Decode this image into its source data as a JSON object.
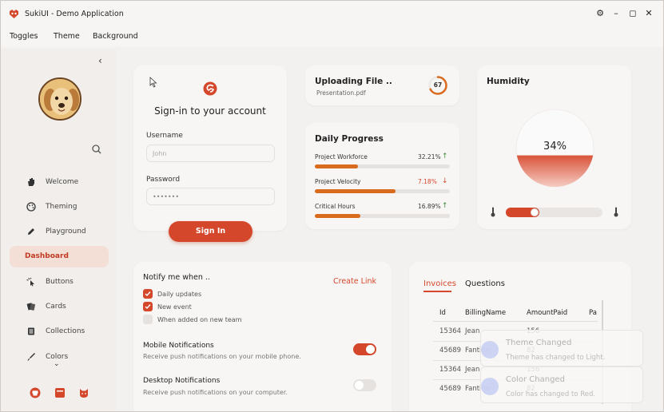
{
  "window": {
    "title": "SukiUI - Demo Application"
  },
  "menu": [
    "Toggles",
    "Theme",
    "Background"
  ],
  "sidebar": {
    "items": [
      {
        "label": "Welcome",
        "icon": "hand-wave-icon"
      },
      {
        "label": "Theming",
        "icon": "palette-icon"
      },
      {
        "label": "Playground",
        "icon": "pencil-icon"
      },
      {
        "label": "Dashboard",
        "icon": "dashboard-icon",
        "active": true
      },
      {
        "label": "Buttons",
        "icon": "cursor-click-icon"
      },
      {
        "label": "Cards",
        "icon": "cards-icon"
      },
      {
        "label": "Collections",
        "icon": "collection-icon"
      },
      {
        "label": "Colors",
        "icon": "brush-icon"
      }
    ],
    "bottom_icons": [
      "github-icon",
      "book-icon",
      "cat-icon"
    ]
  },
  "signin": {
    "title": "Sign-in to your account",
    "username_label": "Username",
    "username_placeholder": "John",
    "password_label": "Password",
    "password_value": "•••••••",
    "button": "Sign In"
  },
  "upload": {
    "title": "Uploading File ..",
    "filename": "Presentation.pdf",
    "progress": "67",
    "progress_fraction": 0.67
  },
  "daily": {
    "title": "Daily Progress",
    "rows": [
      {
        "label": "Project Workforce",
        "value": "32.21%",
        "fraction": 0.3221,
        "trend": "up",
        "color": "#3a3a3a"
      },
      {
        "label": "Project Velocity",
        "value": "7.18%",
        "fraction": 0.6,
        "trend": "down",
        "color": "#d4472b"
      },
      {
        "label": "Critical Hours",
        "value": "16.89%",
        "fraction": 0.34,
        "trend": "up",
        "color": "#3a3a3a"
      }
    ]
  },
  "humidity": {
    "title": "Humidity",
    "value": "34%",
    "fraction": 0.34,
    "slider_fraction": 0.35
  },
  "notify": {
    "title": "Notify me when ..",
    "create_link": "Create Link",
    "checks": [
      {
        "label": "Daily updates",
        "checked": true
      },
      {
        "label": "New event",
        "checked": true
      },
      {
        "label": "When added on new team",
        "checked": false
      }
    ],
    "mobile_title": "Mobile Notifications",
    "mobile_desc": "Receive push notifications on your mobile phone.",
    "mobile_on": true,
    "desktop_title": "Desktop Notifications",
    "desktop_desc": "Receive push notifications on your computer.",
    "desktop_on": false
  },
  "invoices": {
    "tabs": [
      "Invoices",
      "Questions"
    ],
    "columns": [
      "Id",
      "BillingName",
      "AmountPaid",
      "Pa"
    ],
    "rows": [
      [
        "15364",
        "Jean",
        "156"
      ],
      [
        "45689",
        "Fantine",
        "82"
      ],
      [
        "15364",
        "Jean",
        "156"
      ],
      [
        "45689",
        "Fantine",
        "82"
      ]
    ]
  },
  "toasts": [
    {
      "title": "Theme Changed",
      "message": "Theme has changed to Light."
    },
    {
      "title": "Color Changed",
      "message": "Color has changed to Red."
    }
  ],
  "colors": {
    "accent": "#d4472b",
    "orange": "#d96b1f",
    "active_bg": "#f3dfd6"
  }
}
